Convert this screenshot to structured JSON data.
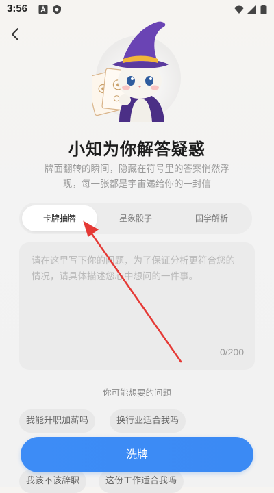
{
  "status_bar": {
    "time": "3:56"
  },
  "header": {
    "title": "小知为你解答疑惑",
    "subtitle": "牌面翻转的瞬间，隐藏在符号里的答案悄然浮现，每一张都是宇宙递给你的一封信"
  },
  "tabs": [
    {
      "label": "卡牌抽牌",
      "active": true
    },
    {
      "label": "星象骰子",
      "active": false
    },
    {
      "label": "国学解析",
      "active": false
    }
  ],
  "question": {
    "placeholder": "请在这里写下你的问题，为了保证分析更符合您的情况，请具体描述您心中想问的一件事。",
    "counter": "0/200"
  },
  "suggestions": {
    "title": "你可能想要的问题",
    "items": [
      "我能升职加薪吗",
      "换行业适合我吗",
      "我该不该辞职",
      "这份工作适合我吗"
    ]
  },
  "actions": {
    "shuffle_label": "洗牌"
  },
  "colors": {
    "accent": "#3b8af4",
    "annotation_arrow": "#e53935"
  }
}
